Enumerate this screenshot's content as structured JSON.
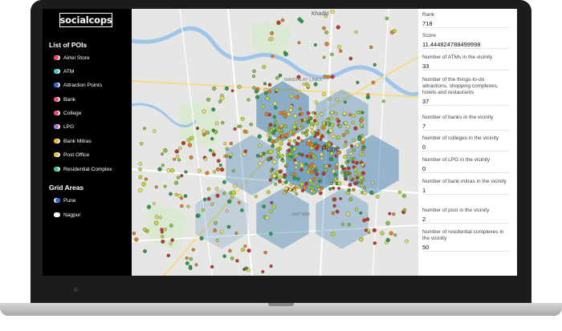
{
  "app": {
    "logo_text": "socialcops"
  },
  "sidebar": {
    "poi_title": "List of POIs",
    "poi_items": [
      {
        "label": "Airtel Store",
        "color": "#e84a5f"
      },
      {
        "label": "ATM",
        "color": "#3ec6c6"
      },
      {
        "label": "Attraction Points",
        "color": "#2b6cd6"
      },
      {
        "label": "Bank",
        "color": "#e84a8a"
      },
      {
        "label": "College",
        "color": "#e84a5f"
      },
      {
        "label": "LPG",
        "color": "#b06ad6"
      },
      {
        "label": "Bank Mitras",
        "color": "#f0b43a"
      },
      {
        "label": "Post Office",
        "color": "#e8c23a"
      },
      {
        "label": "Residential Complex",
        "color": "#3ec68a"
      }
    ],
    "grid_title": "Grid Areas",
    "grid_items": [
      {
        "label": "Pune",
        "color": "#2b6cd6",
        "checked": true
      },
      {
        "label": "Nagpur",
        "color": "#ffffff",
        "checked": false
      }
    ]
  },
  "map": {
    "place_labels": [
      "Khadki",
      "Pune",
      "MANDALAY LINES",
      "DATTAW"
    ],
    "hex_fill": "#1f6aa5",
    "poi_colors": [
      "#8bc34a",
      "#c0d92e",
      "#e8e05a",
      "#2e9a4a",
      "#c0392b",
      "#e67e22"
    ]
  },
  "info_panel": {
    "rows": [
      {
        "label": "Rank",
        "value": "718"
      },
      {
        "label": "Score",
        "value": "11.444824788499998"
      },
      {
        "label": "Number of ATMs in the vicinity",
        "value": "33"
      },
      {
        "label": "Number of the things-to-do attractions, shopping complexes, hotels and restaurants",
        "value": "37"
      },
      {
        "label": "Number of banks in the vicinity",
        "value": "7"
      },
      {
        "label": "Number of colleges in the vicinity",
        "value": "0"
      },
      {
        "label": "Number of LPG in the vicinity",
        "value": "0"
      },
      {
        "label": "Number of bank mitras in the vicinity",
        "value": "1"
      },
      {
        "label": "Number of post in the vicinity",
        "value": "2"
      },
      {
        "label": "Number of residential complexes in the vicinity",
        "value": "50"
      }
    ]
  }
}
